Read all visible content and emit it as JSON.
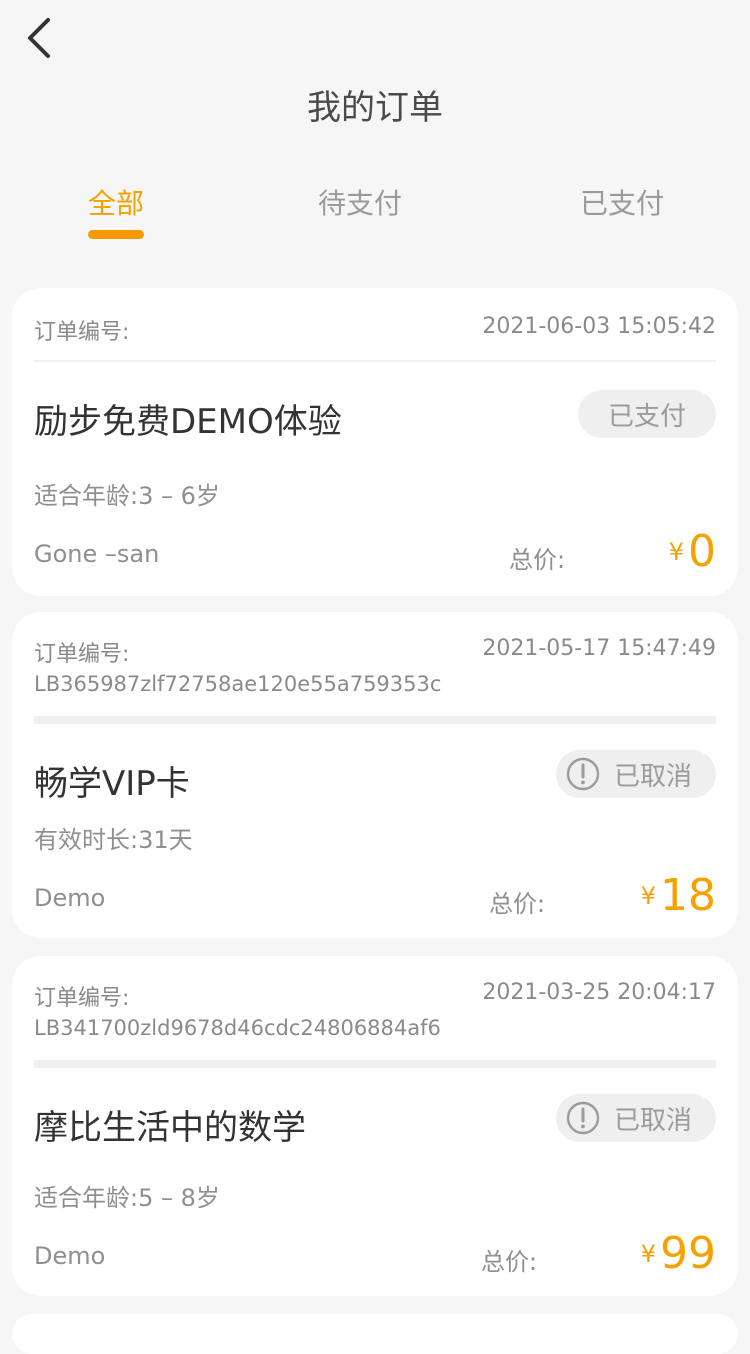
{
  "header": {
    "title": "我的订单"
  },
  "tabs": [
    {
      "label": "全部"
    },
    {
      "label": "待支付"
    },
    {
      "label": "已支付"
    }
  ],
  "orders": [
    {
      "order_label": "订单编号:",
      "time": "2021-06-03 15:05:42",
      "order_no": "",
      "product": "励步免费DEMO体验",
      "status": "已支付",
      "detail": "适合年龄:3 – 6岁",
      "student": "Gone –san",
      "total_label": "总价:",
      "currency": "¥",
      "amount": "0"
    },
    {
      "order_label": "订单编号:",
      "time": "2021-05-17 15:47:49",
      "order_no": "LB365987zlf72758ae120e55a759353c",
      "product": "畅学VIP卡",
      "status": "已取消",
      "detail": "有效时长:31天",
      "student": "Demo",
      "total_label": "总价:",
      "currency": "¥",
      "amount": "18"
    },
    {
      "order_label": "订单编号:",
      "time": "2021-03-25 20:04:17",
      "order_no": "LB341700zld9678d46cdc24806884af6",
      "product": "摩比生活中的数学",
      "status": "已取消",
      "detail": "适合年龄:5 – 8岁",
      "student": "Demo",
      "total_label": "总价:",
      "currency": "¥",
      "amount": "99"
    }
  ],
  "colors": {
    "accent": "#f5a100",
    "background": "#f6f6f6",
    "card": "#ffffff"
  }
}
